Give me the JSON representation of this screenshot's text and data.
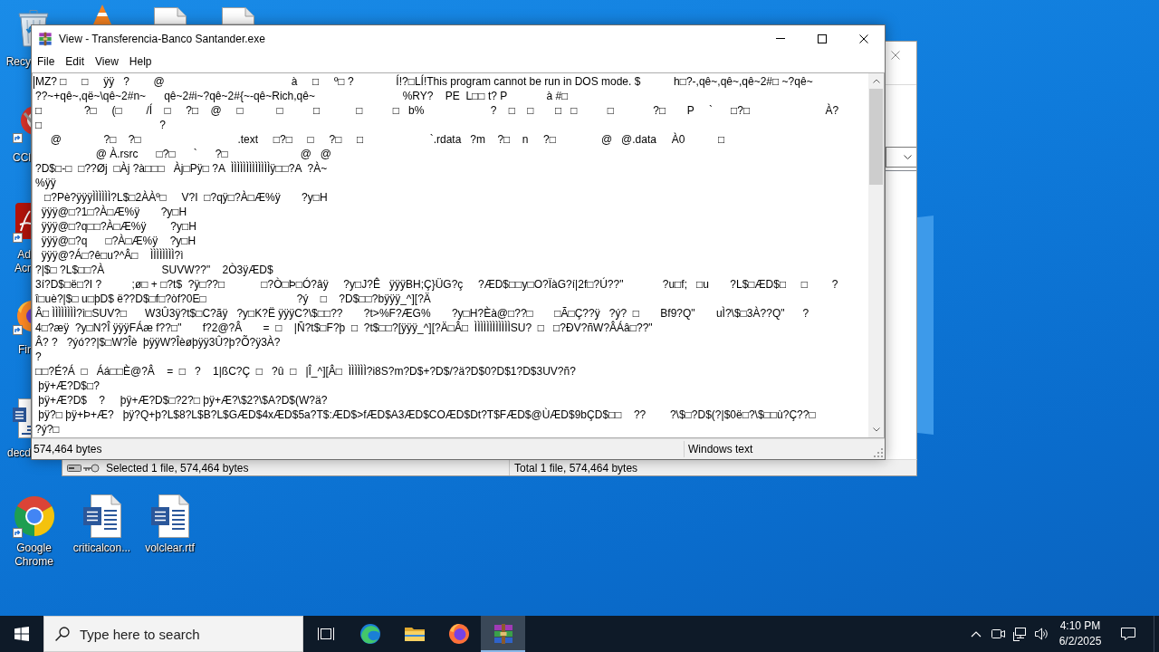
{
  "desktop": {
    "left_column": [
      {
        "label": "Recy"
      },
      {
        "label": "CCl"
      },
      {
        "label": "Ad Acr"
      },
      {
        "label": "Fir"
      },
      {
        "label": "decd"
      }
    ],
    "bottom_row": [
      {
        "label": "Google Chrome"
      },
      {
        "label": "criticalcon..."
      },
      {
        "label": "volclear.rtf"
      }
    ]
  },
  "background_window": {
    "status_bar": {
      "selection": "Selected 1 file, 574,464 bytes",
      "total": "Total 1 file, 574,464 bytes"
    }
  },
  "viewer_window": {
    "title": "View - Transferencia-Banco Santander.exe",
    "menu": [
      "File",
      "Edit",
      "View",
      "Help"
    ],
    "lines": [
      "MZ? □     □     ÿÿ   ?        @                                          à     □     º□ ?              Í!?□LÍ!This program cannot be run in DOS mode. $           h□?-,qê~,qê~,qê~2#□ ~?qê~",
      "??~+qê~,që~\\qê~2#n~      qê~2#i~?qê~2#{~-qê~Rich,qê~                             %RY?    PE  L□□ t? P             à #□",
      "□              ?□     (□        /Í    □     ?□    @     □           □          □            □          □   b%                      ?    □    □       □   □          □             ?□       P     `      □?□                         À?",
      "□                                       ?",
      "     @              ?□    ?□                                .text     □?□     □     ?□     □                      `.rdata   ?m    ?□    n     ?□               @   @.data     À0           □",
      "                    @ À.rsrc      □?□      `      ?□                        @   @",
      "?D$□-□  □??Øj  □Àj ?à□□□   Àj□Pÿ□ ?A  ÌÌÌÌÌÌÌÌÌÌÌÌÌÿ□□?A  ?À~",
      "%ÿÿ",
      "   □?Pè?ÿÿÿÌÌÌÌÌÌ?L$□2ÀÀº□     V?I  □?qÿ□?À□Æ%ÿ       ?y□H",
      "  ÿÿÿ@□?1□?À□Æ%ÿ       ?y□H",
      "  ÿÿÿ@□?q□□?À□Æ%ÿ        ?y□H",
      "  ÿÿÿ@□?q      □?À□Æ%ÿ    ?y□H",
      "  ÿÿÿ@?Á□?ê□u?^Â□    ÌÌÌÌÌÌÌÌ?ì",
      "?|$□ ?L$□□?À                   SUVW??\"    2Ò3ÿÆD$",
      "3í?D$□ë□?I ?          ;ø□ + □?t$  ?ÿ□??□            □?Ò□Þ□Ó?âÿ     ?y□J?Ê   ÿÿÿBH;Ç}ÜG?ç     ?ÆD$□□y□O?ÏàG?í|2f□?Ú??\"             ?u□f;   □u       ?L$□ÆD$□     □        ?",
      "î□uè?|$□ u□þD$ ë??D$□f□?òf?0E□                              ?ý    □    ?D$□□?bÿÿÿ_^][?Ä",
      "Â□ ÌÌÌÌÌÌÌÌ?ì□SUV?□      W3Û3ÿ?t$□C?ãÿ   ?y□K?Ë ÿÿÿC?\\$□□??       ?t>%F?ÆG%       ?y□H?Èà@□??□       □Ã□Ç??ÿ   ?ý?  □       Bf9?Q\"       uÌ?\\$□3À??Q\"      ?",
      "4□?æÿ  ?y□N?Î ÿÿÿFÁæ f??□\"       f?2@?Â       =  □    |Ñ?t$□F?þ  □  ?t$□□?[ÿÿÿ_^][?Ä□Â□  ÌÌÌÌÌÌÌÌÌÌÌÌSU?  □   □?ÐV?ñW?ÂÁâ□??\"",
      "Â? ?   ?ýó??|$□W?Îè  þÿÿW?Îèøþÿÿ3Û?þ?Õ?ÿ3À?",
      "?",
      "□□?É?Á  □   Áá□□È@?Â    =  □   ?    1|ßC?Ç  □   ?û  □   |Î_^][Â□  ÌÌÌÌÌÌ?i8S?m?D$+?D$/?ä?D$0?D$1?D$3UV?ñ?",
      " þÿ+Æ?D$□?",
      " þÿ+Æ?D$    ?     þÿ+Æ?D$□?2?□ þÿ+Æ?\\$2?\\$A?D$(W?ä?",
      " þÿ?□ þÿ+Þ+Æ?   þÿ?Q+þ?L$8?L$B?L$GÆD$4xÆD$5a?T$:ÆD$>fÆD$A3ÆD$COÆD$Dt?T$FÆD$@ÙÆD$9bÇD$□□    ??        ?\\$□?D$(?|$0ë□?\\$□□ù?Ç??□",
      "?ý?□"
    ],
    "status_bar": {
      "size": "574,464 bytes",
      "encoding": "Windows text"
    }
  },
  "taskbar": {
    "search": {
      "placeholder": "Type here to search"
    },
    "apps": [
      {
        "selected": false
      },
      {
        "selected": false
      },
      {
        "selected": false
      },
      {
        "selected": false
      },
      {
        "selected": true
      }
    ],
    "clock": {
      "time": "4:10 PM",
      "date": "6/2/2025"
    }
  }
}
